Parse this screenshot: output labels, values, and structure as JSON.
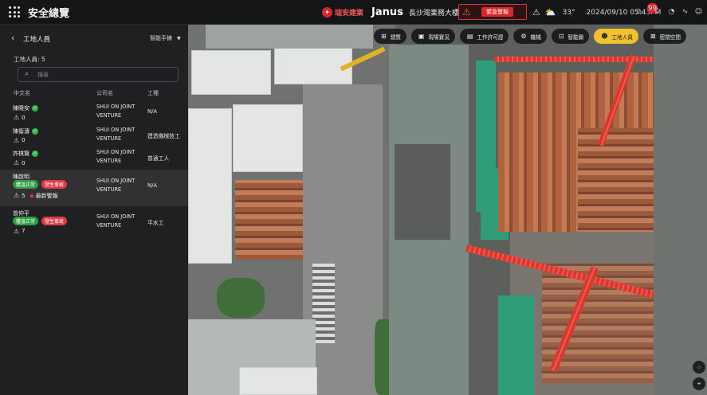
{
  "app": {
    "title": "安全總覽"
  },
  "brand": {
    "company": "瑞安建業",
    "product": "Janus",
    "project": "長沙灣業務大樓"
  },
  "alarm": {
    "label": "緊急警報"
  },
  "weather": {
    "temperature": "33°",
    "datetime": "2024/09/10 05:43PM"
  },
  "notifications": {
    "count": "99"
  },
  "panel": {
    "title": "工地人員",
    "dropdown": "智能手錶",
    "count_label": "工地人員: 5",
    "search_placeholder": "搜尋",
    "columns": {
      "name": "中文名",
      "company": "公司名",
      "trade": "工種"
    },
    "workers": [
      {
        "name": "陳曉安",
        "warnings": "0",
        "company_l1": "SHUI ON JOINT",
        "company_l2": "VENTURE",
        "trade": "N/A"
      },
      {
        "name": "陳衞濤",
        "warnings": "0",
        "company_l1": "SHUI ON JOINT",
        "company_l2": "VENTURE",
        "trade": "建造機械技工"
      },
      {
        "name": "許棋賢",
        "warnings": "0",
        "company_l1": "SHUI ON JOINT",
        "company_l2": "VENTURE",
        "trade": "普通工人"
      },
      {
        "name": "陳啟明",
        "status": "體溫正常",
        "incident": "發生事故",
        "warnings": "5",
        "latest": "最新警報",
        "company_l1": "SHUI ON JOINT",
        "company_l2": "VENTURE",
        "trade": "N/A"
      },
      {
        "name": "曾仲平",
        "status": "體溫正常",
        "incident": "發生事故",
        "warnings": "7",
        "company_l1": "SHUI ON JOINT",
        "company_l2": "VENTURE",
        "trade": "平水工"
      }
    ]
  },
  "toolbar": {
    "chips": [
      {
        "label": "總覽",
        "icon": "layout-icon"
      },
      {
        "label": "現場實況",
        "icon": "camera-icon"
      },
      {
        "label": "工作許可證",
        "icon": "document-icon"
      },
      {
        "label": "機械",
        "icon": "machine-icon"
      },
      {
        "label": "智能鎖",
        "icon": "lock-icon"
      },
      {
        "label": "工地人員",
        "icon": "worker-icon",
        "active": true
      },
      {
        "label": "密閉空間",
        "icon": "confined-space-icon"
      }
    ]
  },
  "colors": {
    "accent": "#f3c12b",
    "alert": "#d8262c",
    "ok": "#2f9e44"
  }
}
